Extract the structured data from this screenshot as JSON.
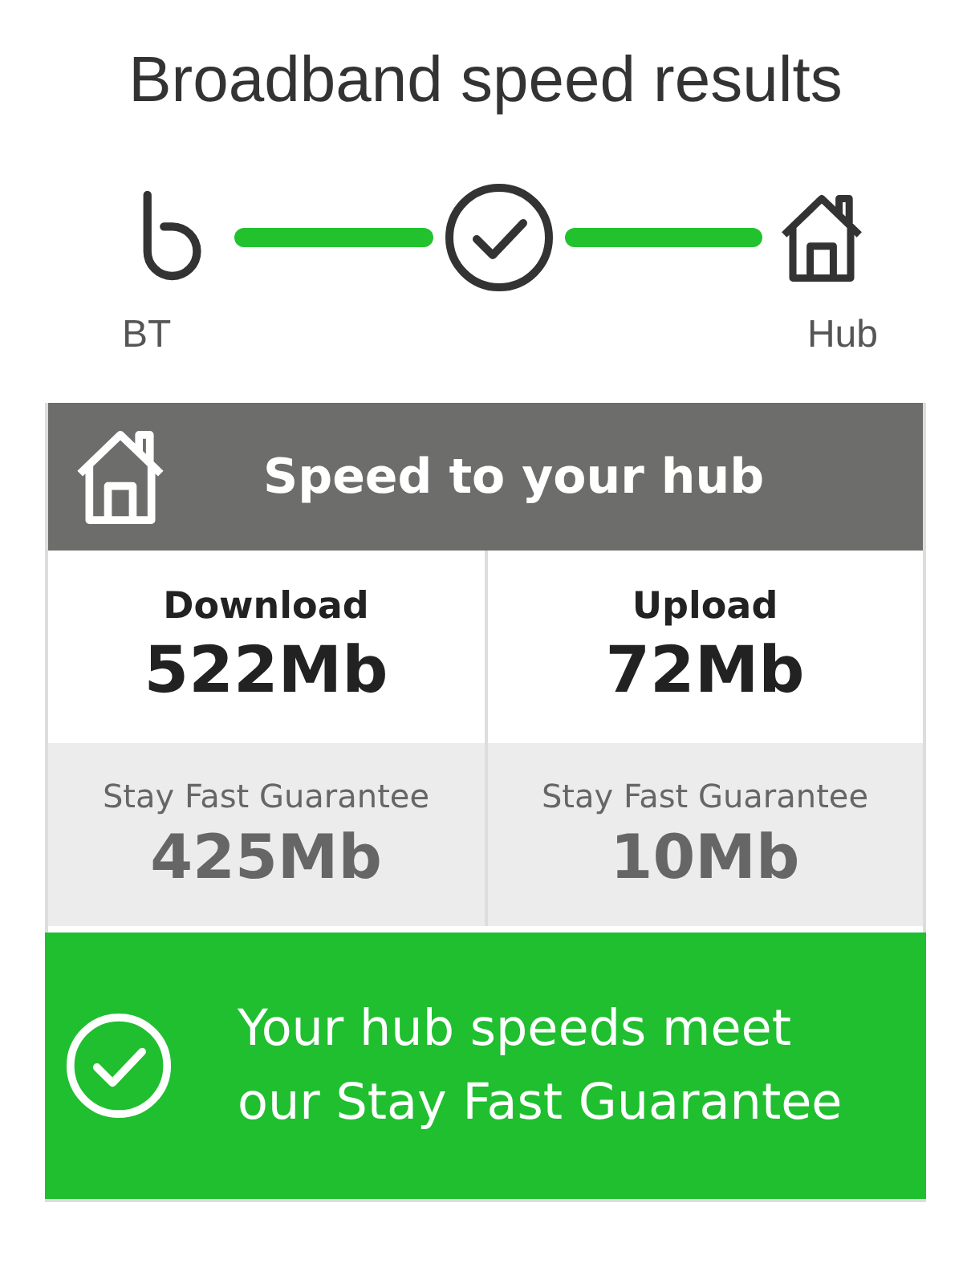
{
  "title": "Broadband speed results",
  "connection": {
    "from_label": "BT",
    "to_label": "Hub",
    "connected": true
  },
  "panel": {
    "heading": "Speed to your hub",
    "columns": [
      {
        "label": "Download",
        "speed": "522Mb",
        "guarantee_label": "Stay Fast Guarantee",
        "guarantee_speed": "425Mb"
      },
      {
        "label": "Upload",
        "speed": "72Mb",
        "guarantee_label": "Stay Fast Guarantee",
        "guarantee_speed": "10Mb"
      }
    ],
    "result": {
      "meets": true,
      "message": "Your hub speeds meet our Stay Fast Guarantee"
    }
  }
}
